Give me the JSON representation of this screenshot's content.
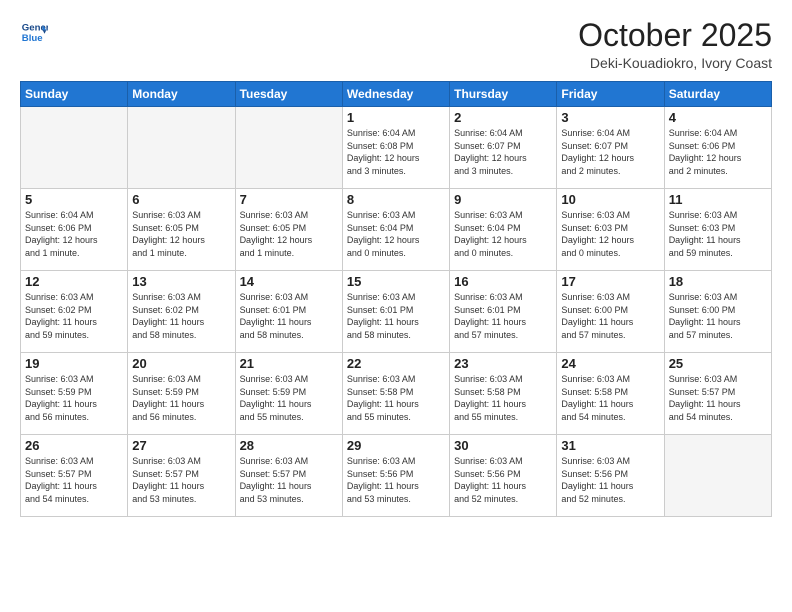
{
  "header": {
    "logo_line1": "General",
    "logo_line2": "Blue",
    "month": "October 2025",
    "location": "Deki-Kouadiokro, Ivory Coast"
  },
  "weekdays": [
    "Sunday",
    "Monday",
    "Tuesday",
    "Wednesday",
    "Thursday",
    "Friday",
    "Saturday"
  ],
  "weeks": [
    [
      {
        "day": "",
        "info": ""
      },
      {
        "day": "",
        "info": ""
      },
      {
        "day": "",
        "info": ""
      },
      {
        "day": "1",
        "info": "Sunrise: 6:04 AM\nSunset: 6:08 PM\nDaylight: 12 hours\nand 3 minutes."
      },
      {
        "day": "2",
        "info": "Sunrise: 6:04 AM\nSunset: 6:07 PM\nDaylight: 12 hours\nand 3 minutes."
      },
      {
        "day": "3",
        "info": "Sunrise: 6:04 AM\nSunset: 6:07 PM\nDaylight: 12 hours\nand 2 minutes."
      },
      {
        "day": "4",
        "info": "Sunrise: 6:04 AM\nSunset: 6:06 PM\nDaylight: 12 hours\nand 2 minutes."
      }
    ],
    [
      {
        "day": "5",
        "info": "Sunrise: 6:04 AM\nSunset: 6:06 PM\nDaylight: 12 hours\nand 1 minute."
      },
      {
        "day": "6",
        "info": "Sunrise: 6:03 AM\nSunset: 6:05 PM\nDaylight: 12 hours\nand 1 minute."
      },
      {
        "day": "7",
        "info": "Sunrise: 6:03 AM\nSunset: 6:05 PM\nDaylight: 12 hours\nand 1 minute."
      },
      {
        "day": "8",
        "info": "Sunrise: 6:03 AM\nSunset: 6:04 PM\nDaylight: 12 hours\nand 0 minutes."
      },
      {
        "day": "9",
        "info": "Sunrise: 6:03 AM\nSunset: 6:04 PM\nDaylight: 12 hours\nand 0 minutes."
      },
      {
        "day": "10",
        "info": "Sunrise: 6:03 AM\nSunset: 6:03 PM\nDaylight: 12 hours\nand 0 minutes."
      },
      {
        "day": "11",
        "info": "Sunrise: 6:03 AM\nSunset: 6:03 PM\nDaylight: 11 hours\nand 59 minutes."
      }
    ],
    [
      {
        "day": "12",
        "info": "Sunrise: 6:03 AM\nSunset: 6:02 PM\nDaylight: 11 hours\nand 59 minutes."
      },
      {
        "day": "13",
        "info": "Sunrise: 6:03 AM\nSunset: 6:02 PM\nDaylight: 11 hours\nand 58 minutes."
      },
      {
        "day": "14",
        "info": "Sunrise: 6:03 AM\nSunset: 6:01 PM\nDaylight: 11 hours\nand 58 minutes."
      },
      {
        "day": "15",
        "info": "Sunrise: 6:03 AM\nSunset: 6:01 PM\nDaylight: 11 hours\nand 58 minutes."
      },
      {
        "day": "16",
        "info": "Sunrise: 6:03 AM\nSunset: 6:01 PM\nDaylight: 11 hours\nand 57 minutes."
      },
      {
        "day": "17",
        "info": "Sunrise: 6:03 AM\nSunset: 6:00 PM\nDaylight: 11 hours\nand 57 minutes."
      },
      {
        "day": "18",
        "info": "Sunrise: 6:03 AM\nSunset: 6:00 PM\nDaylight: 11 hours\nand 57 minutes."
      }
    ],
    [
      {
        "day": "19",
        "info": "Sunrise: 6:03 AM\nSunset: 5:59 PM\nDaylight: 11 hours\nand 56 minutes."
      },
      {
        "day": "20",
        "info": "Sunrise: 6:03 AM\nSunset: 5:59 PM\nDaylight: 11 hours\nand 56 minutes."
      },
      {
        "day": "21",
        "info": "Sunrise: 6:03 AM\nSunset: 5:59 PM\nDaylight: 11 hours\nand 55 minutes."
      },
      {
        "day": "22",
        "info": "Sunrise: 6:03 AM\nSunset: 5:58 PM\nDaylight: 11 hours\nand 55 minutes."
      },
      {
        "day": "23",
        "info": "Sunrise: 6:03 AM\nSunset: 5:58 PM\nDaylight: 11 hours\nand 55 minutes."
      },
      {
        "day": "24",
        "info": "Sunrise: 6:03 AM\nSunset: 5:58 PM\nDaylight: 11 hours\nand 54 minutes."
      },
      {
        "day": "25",
        "info": "Sunrise: 6:03 AM\nSunset: 5:57 PM\nDaylight: 11 hours\nand 54 minutes."
      }
    ],
    [
      {
        "day": "26",
        "info": "Sunrise: 6:03 AM\nSunset: 5:57 PM\nDaylight: 11 hours\nand 54 minutes."
      },
      {
        "day": "27",
        "info": "Sunrise: 6:03 AM\nSunset: 5:57 PM\nDaylight: 11 hours\nand 53 minutes."
      },
      {
        "day": "28",
        "info": "Sunrise: 6:03 AM\nSunset: 5:57 PM\nDaylight: 11 hours\nand 53 minutes."
      },
      {
        "day": "29",
        "info": "Sunrise: 6:03 AM\nSunset: 5:56 PM\nDaylight: 11 hours\nand 53 minutes."
      },
      {
        "day": "30",
        "info": "Sunrise: 6:03 AM\nSunset: 5:56 PM\nDaylight: 11 hours\nand 52 minutes."
      },
      {
        "day": "31",
        "info": "Sunrise: 6:03 AM\nSunset: 5:56 PM\nDaylight: 11 hours\nand 52 minutes."
      },
      {
        "day": "",
        "info": ""
      }
    ]
  ]
}
